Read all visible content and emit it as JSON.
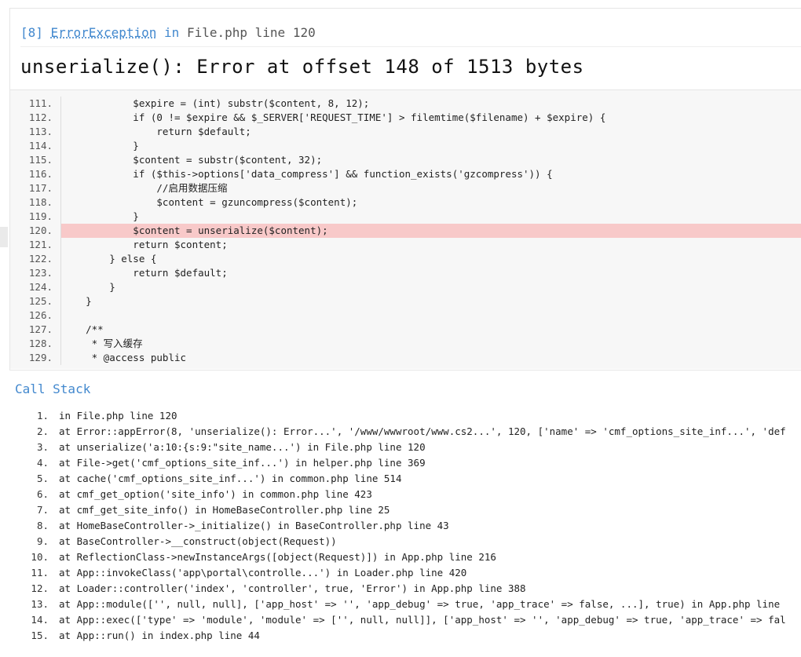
{
  "header": {
    "code_prefix": "[8]",
    "exception_class": "ErrorException",
    "in_word": "in",
    "location": "File.php line 120",
    "message": "unserialize(): Error at offset 148 of 1513 bytes"
  },
  "source": {
    "highlight_line": 120,
    "lines": [
      {
        "no": "111.",
        "text": "            $expire = (int) substr($content, 8, 12);"
      },
      {
        "no": "112.",
        "text": "            if (0 != $expire && $_SERVER['REQUEST_TIME'] > filemtime($filename) + $expire) {"
      },
      {
        "no": "113.",
        "text": "                return $default;"
      },
      {
        "no": "114.",
        "text": "            }"
      },
      {
        "no": "115.",
        "text": "            $content = substr($content, 32);"
      },
      {
        "no": "116.",
        "text": "            if ($this->options['data_compress'] && function_exists('gzcompress')) {"
      },
      {
        "no": "117.",
        "text": "                //启用数据压缩"
      },
      {
        "no": "118.",
        "text": "                $content = gzuncompress($content);"
      },
      {
        "no": "119.",
        "text": "            }"
      },
      {
        "no": "120.",
        "text": "            $content = unserialize($content);"
      },
      {
        "no": "121.",
        "text": "            return $content;"
      },
      {
        "no": "122.",
        "text": "        } else {"
      },
      {
        "no": "123.",
        "text": "            return $default;"
      },
      {
        "no": "124.",
        "text": "        }"
      },
      {
        "no": "125.",
        "text": "    }"
      },
      {
        "no": "126.",
        "text": ""
      },
      {
        "no": "127.",
        "text": "    /**"
      },
      {
        "no": "128.",
        "text": "     * 写入缓存"
      },
      {
        "no": "129.",
        "text": "     * @access public"
      }
    ]
  },
  "call_stack": {
    "title": "Call Stack",
    "rows": [
      {
        "no": "1.",
        "text": "in File.php line 120"
      },
      {
        "no": "2.",
        "text": "at Error::appError(8, 'unserialize(): Error...', '/www/wwwroot/www.cs2...', 120, ['name' => 'cmf_options_site_inf...', 'def"
      },
      {
        "no": "3.",
        "text": "at unserialize('a:10:{s:9:\"site_name...') in File.php line 120"
      },
      {
        "no": "4.",
        "text": "at File->get('cmf_options_site_inf...') in helper.php line 369"
      },
      {
        "no": "5.",
        "text": "at cache('cmf_options_site_inf...') in common.php line 514"
      },
      {
        "no": "6.",
        "text": "at cmf_get_option('site_info') in common.php line 423"
      },
      {
        "no": "7.",
        "text": "at cmf_get_site_info() in HomeBaseController.php line 25"
      },
      {
        "no": "8.",
        "text": "at HomeBaseController->_initialize() in BaseController.php line 43"
      },
      {
        "no": "9.",
        "text": "at BaseController->__construct(object(Request))"
      },
      {
        "no": "10.",
        "text": "at ReflectionClass->newInstanceArgs([object(Request)]) in App.php line 216"
      },
      {
        "no": "11.",
        "text": "at App::invokeClass('app\\portal\\controlle...') in Loader.php line 420"
      },
      {
        "no": "12.",
        "text": "at Loader::controller('index', 'controller', true, 'Error') in App.php line 388"
      },
      {
        "no": "13.",
        "text": "at App::module(['', null, null], ['app_host' => '', 'app_debug' => true, 'app_trace' => false, ...], true) in App.php line"
      },
      {
        "no": "14.",
        "text": "at App::exec(['type' => 'module', 'module' => ['', null, null]], ['app_host' => '', 'app_debug' => true, 'app_trace' => fal"
      },
      {
        "no": "15.",
        "text": "at App::run() in index.php line 44"
      }
    ]
  },
  "colors": {
    "accent": "#4288ce",
    "highlight": "#f8c9c9",
    "code_bg": "#f7f7f7"
  }
}
